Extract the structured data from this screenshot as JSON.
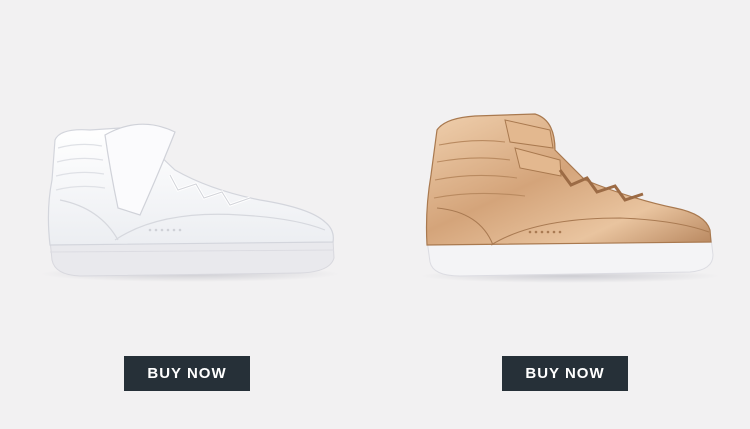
{
  "products": [
    {
      "image": "white-high-top-sneaker",
      "button_label": "BUY NOW",
      "colors": {
        "upper": "#f7f7f9",
        "sole": "#e9e9ed"
      }
    },
    {
      "image": "rose-gold-metallic-high-top-sneaker",
      "button_label": "BUY NOW",
      "colors": {
        "upper": "#d6ab84",
        "sole": "#f4f4f6"
      }
    }
  ],
  "theme": {
    "background": "#f2f1f2",
    "button_bg": "#263038",
    "button_text": "#ffffff"
  }
}
